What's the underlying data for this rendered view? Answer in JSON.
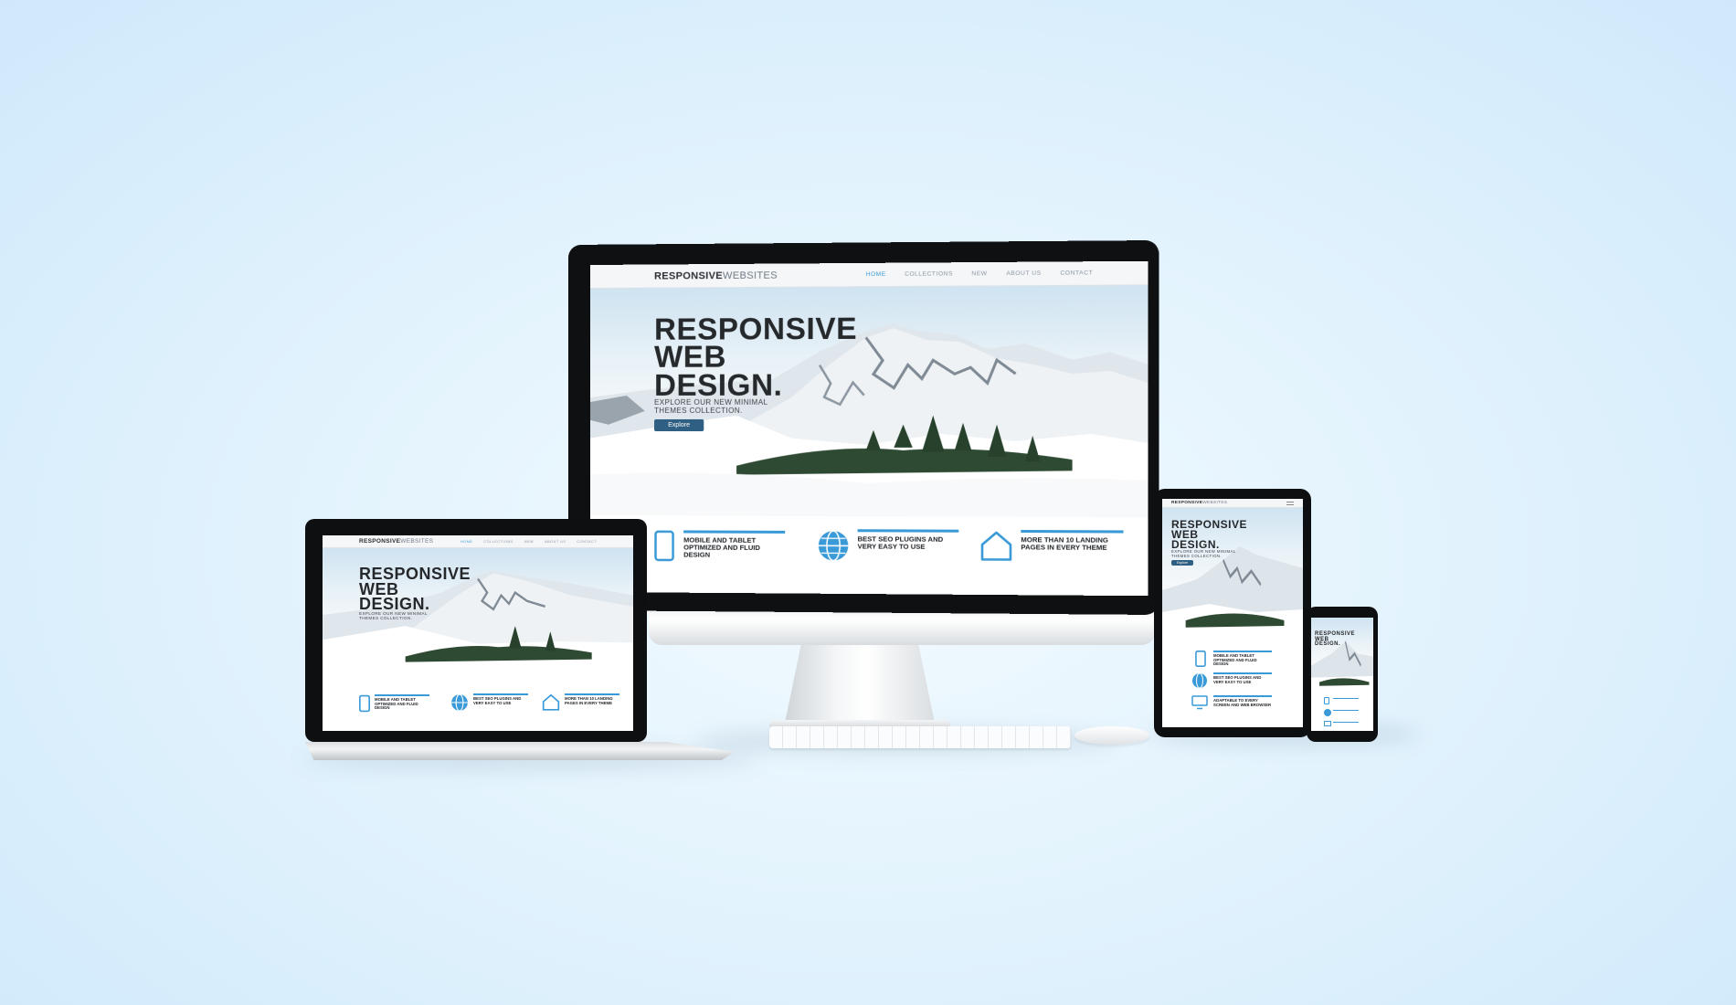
{
  "site": {
    "logo_bold": "RESPONSIVE",
    "logo_light": "WEBSITES",
    "nav": [
      "HOME",
      "COLLECTIONS",
      "NEW",
      "ABOUT US",
      "CONTACT"
    ],
    "hero_title": [
      "RESPONSIVE",
      "WEB",
      "DESIGN."
    ],
    "hero_subtitle": [
      "EXPLORE OUR NEW MINIMAL",
      "THEMES COLLECTION."
    ],
    "explore_button": "Explore",
    "features": [
      {
        "icon": "tablet-icon",
        "text": "MOBILE AND TABLET OPTIMIZED AND FLUID DESIGN"
      },
      {
        "icon": "globe-icon",
        "text": "BEST SEO PLUGINS AND VERY EASY TO USE"
      },
      {
        "icon": "house-icon",
        "text": "MORE THAN 10 LANDING PAGES IN EVERY THEME"
      }
    ],
    "tablet_feature_3": {
      "icon": "monitor-icon",
      "text": "ADAPTABLE TO EVERY SCREEN AND WEB BROWSER"
    }
  },
  "colors": {
    "accent": "#3a9ad8",
    "button": "#2f5f83",
    "title": "#26292c",
    "background": "#e3f3fd"
  }
}
